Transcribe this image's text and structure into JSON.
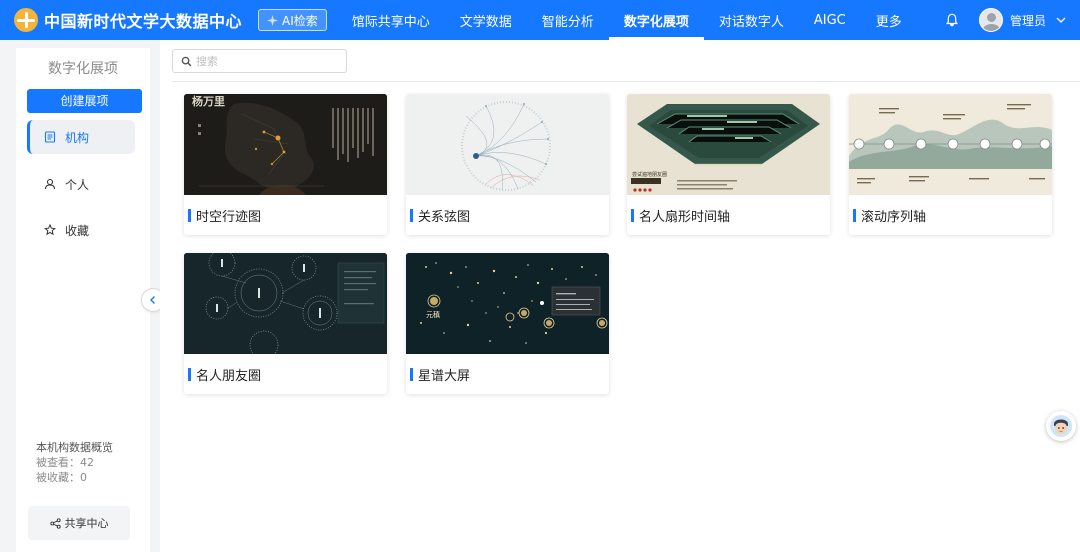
{
  "header": {
    "logo_text": "中国新时代文学大数据中心",
    "ai_button": "AI检索",
    "nav": [
      {
        "label": "馆际共享中心"
      },
      {
        "label": "文学数据"
      },
      {
        "label": "智能分析"
      },
      {
        "label": "数字化展项",
        "active": true
      },
      {
        "label": "对话数字人"
      },
      {
        "label": "AIGC"
      },
      {
        "label": "更多"
      }
    ],
    "user_name": "管理员",
    "brand_color": "#1677ff"
  },
  "sidebar": {
    "title": "数字化展项",
    "create_button": "创建展项",
    "items": [
      {
        "label": "机构",
        "icon": "document-icon",
        "active": true
      },
      {
        "label": "个人",
        "icon": "user-icon"
      },
      {
        "label": "收藏",
        "icon": "star-icon"
      }
    ],
    "stats": {
      "heading": "本机构数据概览",
      "viewed": "被查看：42",
      "favorited": "被收藏：0"
    },
    "share_button": "共享中心"
  },
  "search": {
    "placeholder": "搜索",
    "value": ""
  },
  "cards": [
    {
      "title": "时空行迹图",
      "thumb": "dark-map"
    },
    {
      "title": "关系弦图",
      "thumb": "chord"
    },
    {
      "title": "名人扇形时间轴",
      "thumb": "fan"
    },
    {
      "title": "滚动序列轴",
      "thumb": "landscape"
    },
    {
      "title": "名人朋友圈",
      "thumb": "circles"
    },
    {
      "title": "星谱大屏",
      "thumb": "stars"
    }
  ],
  "thumb_text": {
    "map_title": "杨万里",
    "stars_name": "元稹",
    "fan_heading": "尝试遍地朋友圈"
  }
}
